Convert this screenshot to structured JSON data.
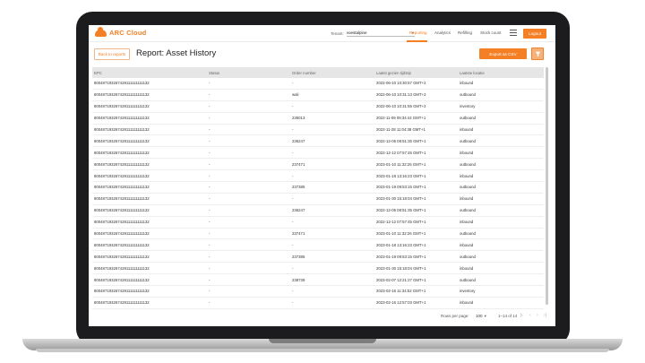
{
  "nav": {
    "brand": "ARC Cloud",
    "tenant_label": "Tenant:",
    "tenant_value": "voestalpine",
    "links": [
      "Reporting",
      "Analytics",
      "Refilling",
      "Stock count"
    ],
    "logout_label": "Logout"
  },
  "header": {
    "back_label": "Back to reports",
    "title": "Report: Asset History",
    "export_label": "Export as CSV"
  },
  "table": {
    "columns": [
      "EPC",
      "Status",
      "Order number",
      "Laatst gezien tijdstip",
      "Laatste locatie"
    ],
    "rows": [
      [
        "800487193267428111111111132",
        "-",
        "-",
        "2022-06-10 10:30:57 GMT+2",
        "inbound"
      ],
      [
        "800487193267428111111111132",
        "-",
        "wali",
        "2022-06-10 10:31:13 GMT+2",
        "outbound"
      ],
      [
        "800487193267428111111111132",
        "-",
        "-",
        "2022-06-10 10:31:55 GMT+2",
        "inventory"
      ],
      [
        "800487193267428111111111132",
        "-",
        "235013",
        "2022-11-09 09:34:44 GMT+1",
        "outbound"
      ],
      [
        "800487193267428111111111132",
        "-",
        "-",
        "2022-11-28 11:04:38 GMT+1",
        "inbound"
      ],
      [
        "800487193267428111111111132",
        "-",
        "236247",
        "2022-12-05 08:51:35 GMT+1",
        "outbound"
      ],
      [
        "800487193267428111111111132",
        "-",
        "-",
        "2022-12-12 07:57:45 GMT+1",
        "inbound"
      ],
      [
        "800487193267428111111111132",
        "-",
        "237471",
        "2023-01-10 11:32:26 GMT+1",
        "outbound"
      ],
      [
        "800487193267428111111111132",
        "-",
        "-",
        "2023-01-18 13:16:23 GMT+1",
        "inbound"
      ],
      [
        "800487193267428111111111132",
        "-",
        "237385",
        "2023-01-19 09:53:15 GMT+1",
        "outbound"
      ],
      [
        "800487193267428111111111132",
        "-",
        "-",
        "2023-01-30 15:18:04 GMT+1",
        "inbound"
      ],
      [
        "800487193267428111111111132",
        "-",
        "236247",
        "2022-12-05 08:51:35 GMT+1",
        "outbound"
      ],
      [
        "800487193267428111111111132",
        "-",
        "-",
        "2022-12-12 07:57:45 GMT+1",
        "inbound"
      ],
      [
        "800487193267428111111111132",
        "-",
        "237471",
        "2023-01-10 11:32:26 GMT+1",
        "outbound"
      ],
      [
        "800487193267428111111111132",
        "-",
        "-",
        "2023-01-18 13:16:23 GMT+1",
        "inbound"
      ],
      [
        "800487193267428111111111132",
        "-",
        "237385",
        "2023-01-19 09:53:15 GMT+1",
        "outbound"
      ],
      [
        "800487193267428111111111132",
        "-",
        "-",
        "2023-01-30 15:18:04 GMT+1",
        "inbound"
      ],
      [
        "800487193267428111111111132",
        "-",
        "238739",
        "2023-02-07 12:21:27 GMT+1",
        "outbound"
      ],
      [
        "800487193267428111111111132",
        "-",
        "-",
        "2023-02-16 11:34:52 GMT+1",
        "inventory"
      ],
      [
        "800487193267428111111111132",
        "-",
        "-",
        "2023-02-16 12:57:03 GMT+1",
        "inbound"
      ]
    ]
  },
  "footer": {
    "rows_per_page_label": "Rows per page:",
    "rows_per_page_value": "100",
    "range": "1–14 of 14",
    "pager": [
      "|‹",
      "‹",
      "›",
      "›|"
    ]
  },
  "colors": {
    "accent": "#f47f24",
    "header_bg": "#e6e6e6"
  }
}
